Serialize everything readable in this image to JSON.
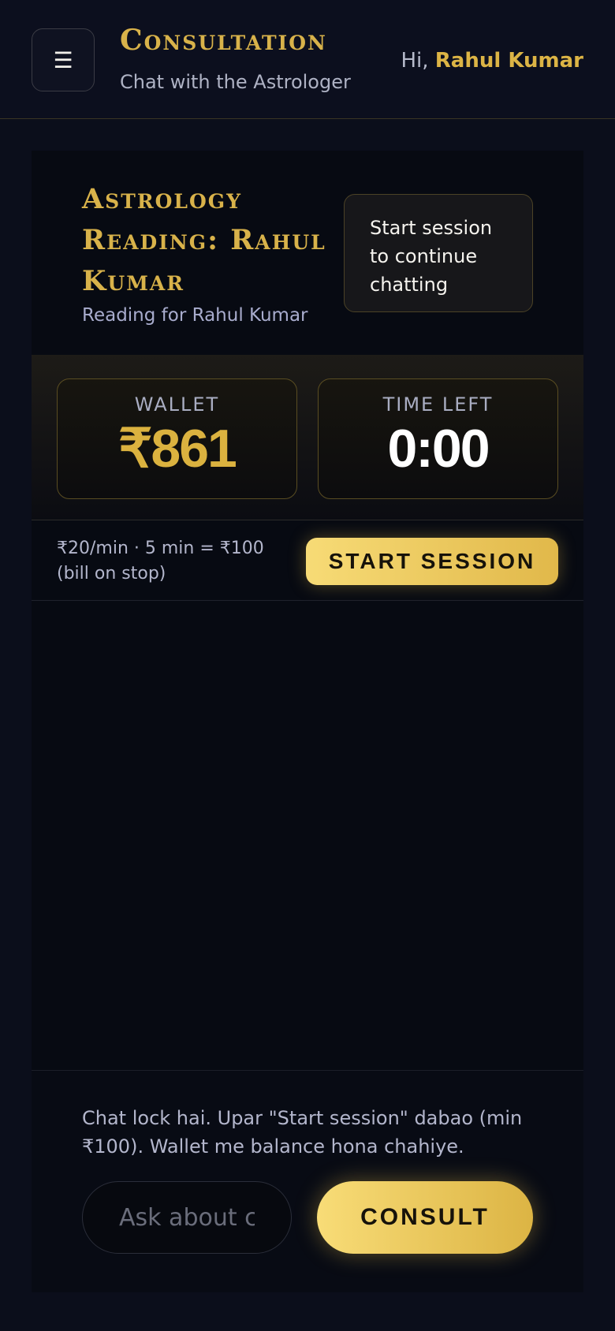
{
  "header": {
    "menu_icon": "☰",
    "title": "Consultation",
    "subtitle": "Chat with the Astrologer",
    "greeting_prefix": "Hi, ",
    "user_name": "Rahul Kumar"
  },
  "reading": {
    "title": "Astrology Reading: Rahul Kumar",
    "subtitle": "Reading for Rahul Kumar",
    "notice": "Start session to continue chatting"
  },
  "stats": {
    "wallet_label": "WALLET",
    "wallet_value": "₹861",
    "time_label": "TIME LEFT",
    "time_value": "0:00"
  },
  "session": {
    "rate_text": "₹20/min · 5 min = ₹100 (bill on stop)",
    "start_label": "START SESSION"
  },
  "composer": {
    "lock_message": "Chat lock hai. Upar \"Start session\" dabao (min ₹100). Wallet me balance hona chahiye.",
    "input_placeholder": "Ask about career, love, health…",
    "consult_label": "CONSULT"
  },
  "colors": {
    "background": "#0b0e1b",
    "gold": "#d8b24a",
    "button_gradient_start": "#f7db76",
    "button_gradient_end": "#e1b84a"
  }
}
